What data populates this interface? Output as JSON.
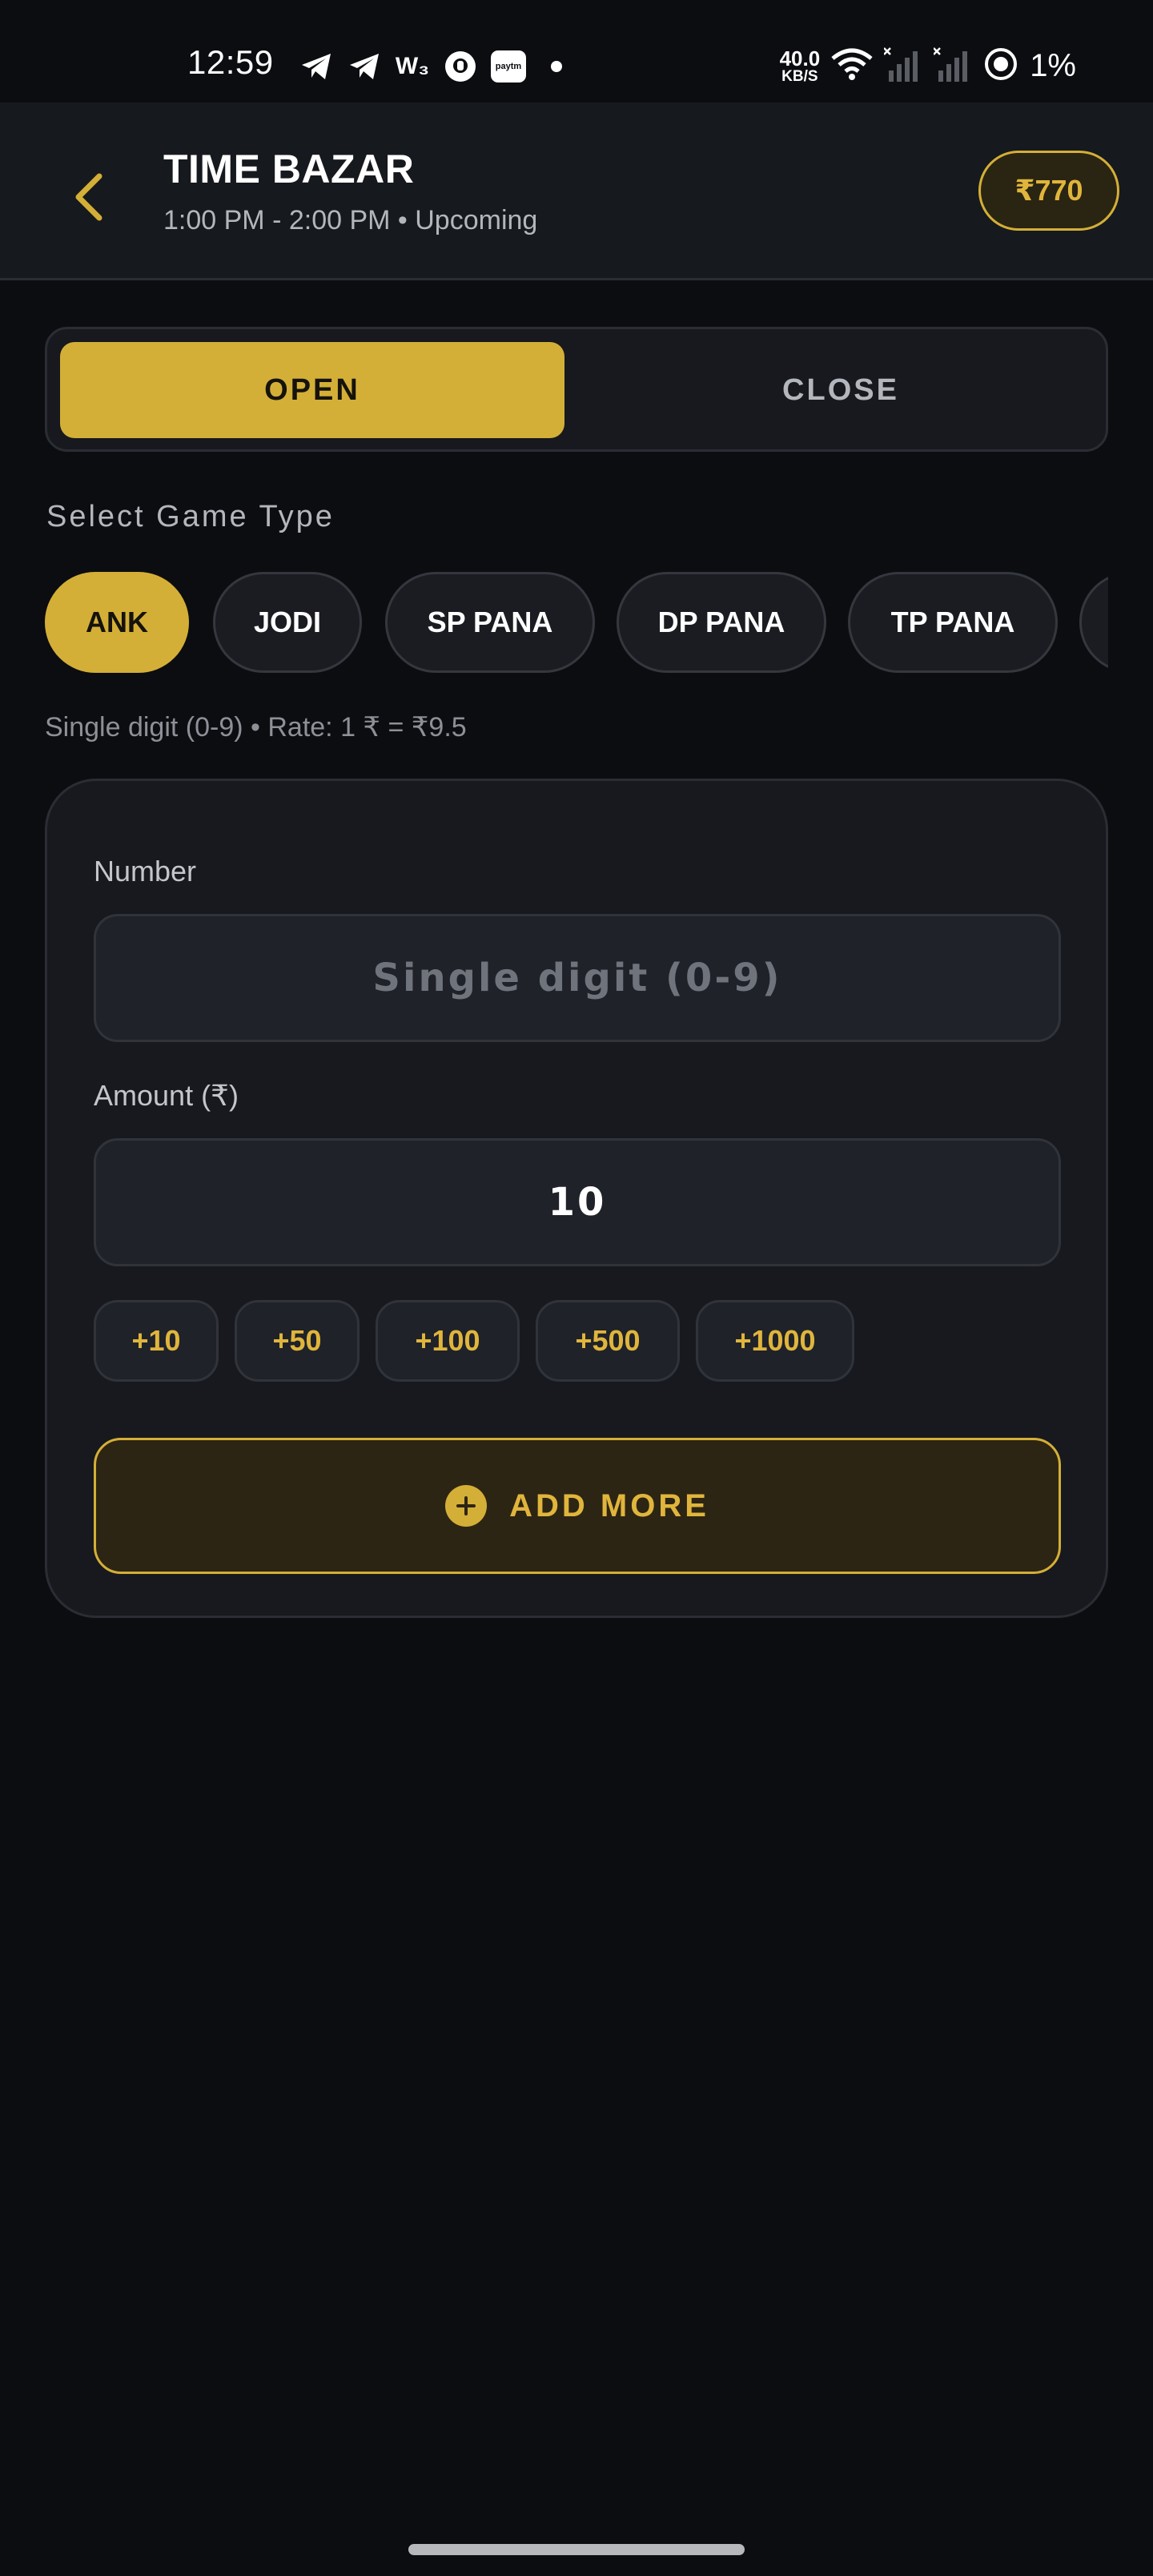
{
  "status_bar": {
    "time": "12:59",
    "net_speed_value": "40.0",
    "net_speed_unit": "KB/S",
    "battery": "1%",
    "icons": [
      "telegram-icon",
      "telegram-icon",
      "w3-icon",
      "chat-icon",
      "paytm-icon",
      "dot-icon",
      "wifi-icon",
      "signal-icon",
      "signal-icon",
      "battery-saver-icon"
    ],
    "paytm_label": "paytm",
    "w3_label": "W₃"
  },
  "header": {
    "title": "TIME BAZAR",
    "subtitle": "1:00 PM - 2:00 PM • Upcoming",
    "wallet_balance": "₹770"
  },
  "session": {
    "open_label": "OPEN",
    "close_label": "CLOSE",
    "selected": "OPEN"
  },
  "game_type": {
    "label": "Select Game Type",
    "chips": [
      {
        "label": "ANK",
        "active": true
      },
      {
        "label": "JODI",
        "active": false
      },
      {
        "label": "SP PANA",
        "active": false
      },
      {
        "label": "DP PANA",
        "active": false
      },
      {
        "label": "TP PANA",
        "active": false
      },
      {
        "label": "",
        "active": false
      }
    ],
    "rate_text": "Single digit (0-9) • Rate: 1 ₹ = ₹9.5"
  },
  "bet_card": {
    "number_label": "Number",
    "number_placeholder": "Single digit (0-9)",
    "number_value": "",
    "amount_label": "Amount (₹)",
    "amount_value": "10",
    "quick_amounts": [
      "+10",
      "+50",
      "+100",
      "+500",
      "+1000"
    ],
    "add_more_label": "ADD MORE"
  },
  "colors": {
    "accent": "#d4af37",
    "background": "#0c0d11",
    "card": "#17191e"
  }
}
